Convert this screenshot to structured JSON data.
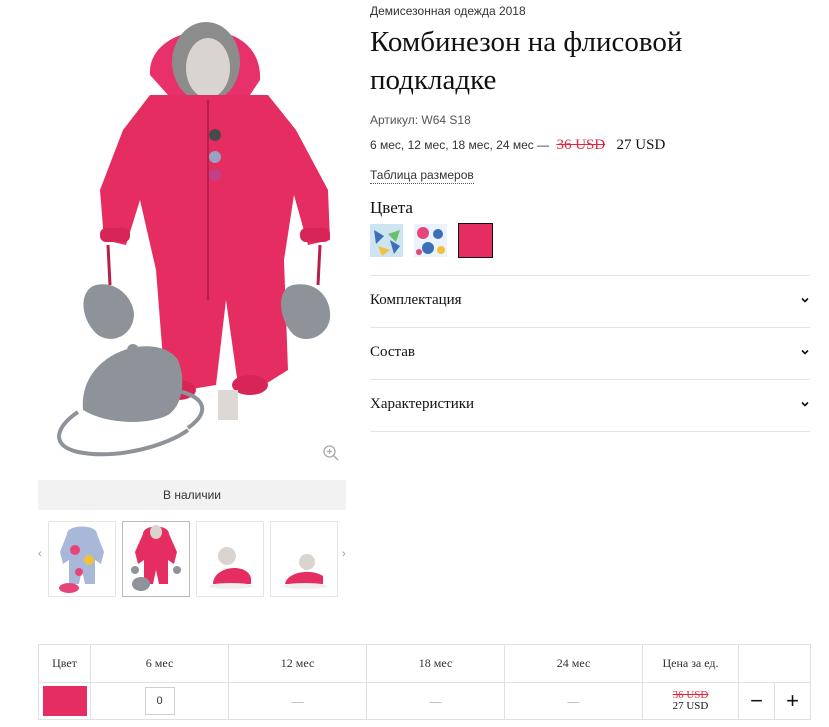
{
  "product": {
    "category": "Демисезонная одежда 2018",
    "title": "Комбинезон на флисовой подкладке",
    "sku_label": "Артикул:",
    "sku_value": "W64 S18",
    "sizes_text": "6 мес, 12 мес, 18 мес, 24 мес —",
    "old_price": "36 USD",
    "new_price": "27 USD",
    "size_table_link": "Таблица размеров",
    "availability": "В наличии"
  },
  "gallery": {
    "main_image_icon": "pink-baby-snowsuit-with-hat-and-mittens",
    "zoom_icon": "zoom-in-icon",
    "prev_arrow": "‹",
    "next_arrow": "›",
    "thumbs": [
      {
        "icon": "floral-snowsuit-thumbnail"
      },
      {
        "icon": "pink-snowsuit-thumbnail"
      },
      {
        "icon": "child-sitting-photo-thumbnail"
      },
      {
        "icon": "child-crawling-photo-thumbnail"
      }
    ]
  },
  "colors": {
    "heading": "Цвета",
    "swatches": [
      {
        "name": "butterfly-print",
        "color": "#6fb3d6"
      },
      {
        "name": "floral-print",
        "color": "#3d6fb8"
      },
      {
        "name": "pink",
        "color": "#e62d61",
        "selected": true
      }
    ]
  },
  "accordion": [
    {
      "label": "Комплектация"
    },
    {
      "label": "Состав"
    },
    {
      "label": "Характеристики"
    }
  ],
  "table": {
    "headers": [
      "Цвет",
      "6 мес",
      "12 мес",
      "18 мес",
      "24 мес",
      "Цена за ед."
    ],
    "row": {
      "swatch_color": "#e62d61",
      "qty": "0",
      "empty": "—",
      "old_price": "36 USD",
      "new_price": "27 USD",
      "minus": "−",
      "plus": "+"
    }
  }
}
